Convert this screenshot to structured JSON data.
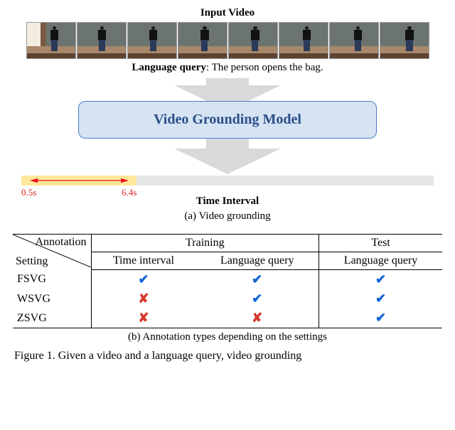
{
  "headings": {
    "input_video": "Input Video",
    "lang_query_label": "Language query",
    "lang_query_text": ": The person opens the bag.",
    "model_box": "Video Grounding Model",
    "time_interval": "Time Interval",
    "subcaption_a": "(a) Video grounding",
    "subcaption_b": "(b) Annotation types depending on the settings"
  },
  "times": {
    "start": "0.5s",
    "end": "6.4s"
  },
  "table": {
    "diag_top": "Annotation",
    "diag_bot": "Setting",
    "group_train": "Training",
    "group_test": "Test",
    "col_time": "Time interval",
    "col_lang_train": "Language query",
    "col_lang_test": "Language query",
    "rows": [
      {
        "name": "FSVG",
        "time": "check",
        "lq_train": "check",
        "lq_test": "check"
      },
      {
        "name": "WSVG",
        "time": "cross",
        "lq_train": "check",
        "lq_test": "check"
      },
      {
        "name": "ZSVG",
        "time": "cross",
        "lq_train": "cross",
        "lq_test": "check"
      }
    ]
  },
  "glyphs": {
    "check": "✔",
    "cross": "✘"
  },
  "caption": "Figure 1.  Given a video and a language query, video grounding",
  "chart_data": {
    "type": "table",
    "title": "Annotation types depending on the settings",
    "columns": [
      "Setting",
      "Training / Time interval",
      "Training / Language query",
      "Test / Language query"
    ],
    "rows": [
      [
        "FSVG",
        true,
        true,
        true
      ],
      [
        "WSVG",
        false,
        true,
        true
      ],
      [
        "ZSVG",
        false,
        false,
        true
      ]
    ],
    "diagram": {
      "task": "Video grounding",
      "input": [
        "Input Video (8 frames)",
        "Language query: The person opens the bag."
      ],
      "model": "Video Grounding Model",
      "output": {
        "type": "time_interval",
        "start_s": 0.5,
        "end_s": 6.4
      }
    }
  }
}
